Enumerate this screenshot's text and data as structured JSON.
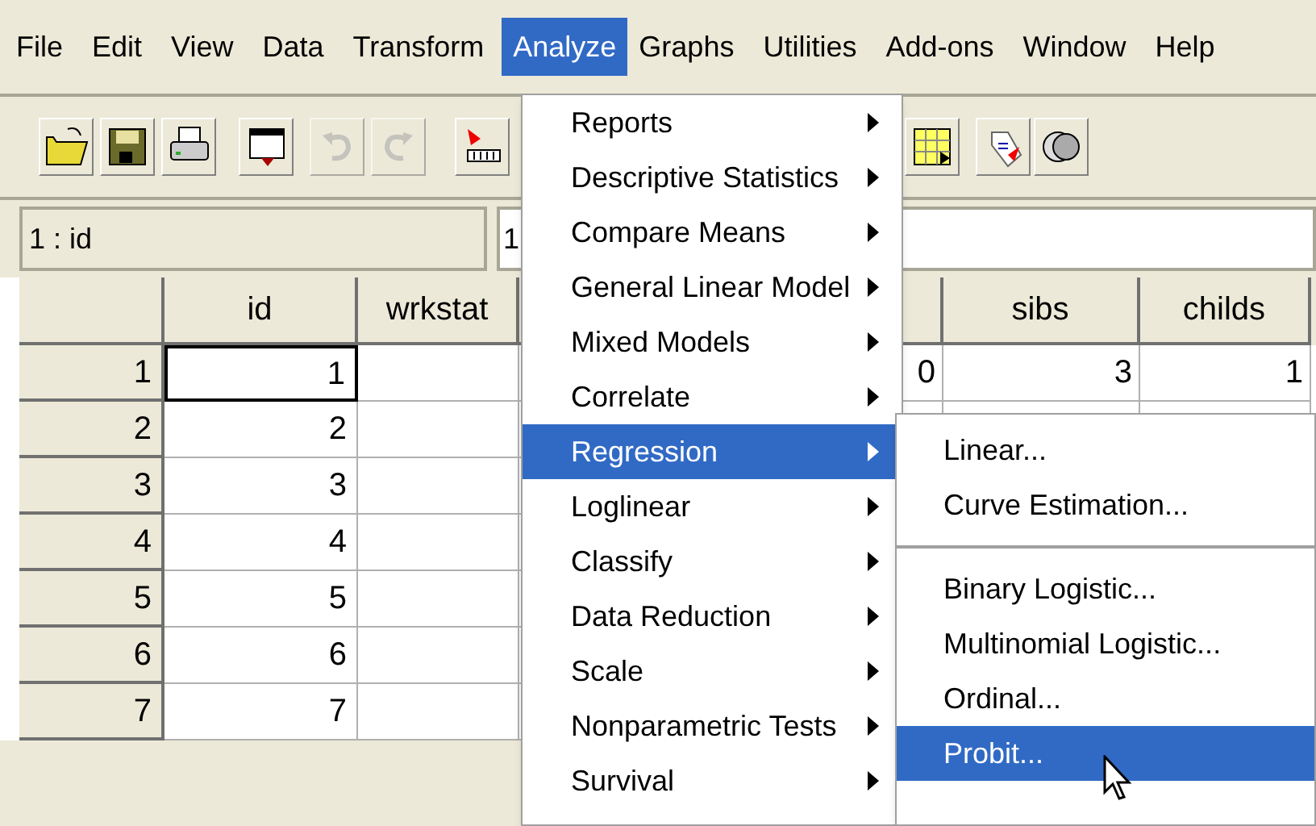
{
  "menu_bar": [
    {
      "label": "File",
      "selected": false
    },
    {
      "label": "Edit",
      "selected": false
    },
    {
      "label": "View",
      "selected": false
    },
    {
      "label": "Data",
      "selected": false
    },
    {
      "label": "Transform",
      "selected": false
    },
    {
      "label": "Analyze",
      "selected": true
    },
    {
      "label": "Graphs",
      "selected": false
    },
    {
      "label": "Utilities",
      "selected": false
    },
    {
      "label": "Add-ons",
      "selected": false
    },
    {
      "label": "Window",
      "selected": false
    },
    {
      "label": "Help",
      "selected": false
    }
  ],
  "toolbar": [
    {
      "kind": "open",
      "disabled": false
    },
    {
      "kind": "save",
      "disabled": false
    },
    {
      "kind": "print",
      "disabled": false
    },
    {
      "kind": "dialog",
      "disabled": false
    },
    {
      "kind": "undo",
      "disabled": true
    },
    {
      "kind": "redo",
      "disabled": true
    },
    {
      "kind": "goto",
      "disabled": false
    },
    {
      "kind": "grid",
      "disabled": false
    },
    {
      "kind": "label",
      "disabled": false
    },
    {
      "kind": "sets",
      "disabled": false
    }
  ],
  "cell_editor": {
    "variable": "1 : id",
    "value": "1"
  },
  "table": {
    "columns": [
      "id",
      "wrkstat",
      "sibs",
      "childs"
    ],
    "rows": [
      {
        "row": "1",
        "id": "1",
        "selected": true,
        "column_3": "0",
        "sibs": "3",
        "childs": "1"
      },
      {
        "row": "2",
        "id": "2",
        "selected": false
      },
      {
        "row": "3",
        "id": "3",
        "selected": false
      },
      {
        "row": "4",
        "id": "4",
        "selected": false
      },
      {
        "row": "5",
        "id": "5",
        "selected": false
      },
      {
        "row": "6",
        "id": "6",
        "selected": false
      },
      {
        "row": "7",
        "id": "7",
        "selected": false
      }
    ]
  },
  "analyze_menu": [
    {
      "label": "Reports",
      "selected": false
    },
    {
      "label": "Descriptive Statistics",
      "selected": false
    },
    {
      "label": "Compare Means",
      "selected": false
    },
    {
      "label": "General Linear Model",
      "selected": false
    },
    {
      "label": "Mixed Models",
      "selected": false
    },
    {
      "label": "Correlate",
      "selected": false
    },
    {
      "label": "Regression",
      "selected": true
    },
    {
      "label": "Loglinear",
      "selected": false
    },
    {
      "label": "Classify",
      "selected": false
    },
    {
      "label": "Data Reduction",
      "selected": false
    },
    {
      "label": "Scale",
      "selected": false
    },
    {
      "label": "Nonparametric Tests",
      "selected": false
    },
    {
      "label": "Survival",
      "selected": false
    }
  ],
  "regression_submenu": [
    {
      "kind": "item",
      "label": "Linear...",
      "selected": false
    },
    {
      "kind": "item",
      "label": "Curve Estimation...",
      "selected": false
    },
    {
      "kind": "separator"
    },
    {
      "kind": "item",
      "label": "Binary Logistic...",
      "selected": false
    },
    {
      "kind": "item",
      "label": "Multinomial Logistic...",
      "selected": false
    },
    {
      "kind": "item",
      "label": "Ordinal...",
      "selected": false
    },
    {
      "kind": "item",
      "label": "Probit...",
      "selected": true
    }
  ]
}
